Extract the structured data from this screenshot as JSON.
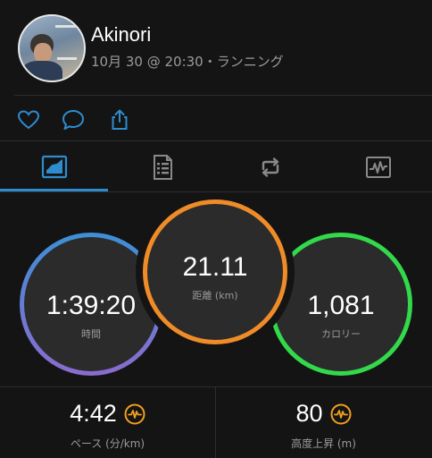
{
  "header": {
    "user_name": "Akinori",
    "activity_meta": "10月 30 @ 20:30・ランニング"
  },
  "actions": {
    "like_icon": "heart-icon",
    "comment_icon": "speech-bubble-icon",
    "share_icon": "share-icon"
  },
  "tabs": [
    {
      "icon": "summary-chart-icon",
      "selected": true
    },
    {
      "icon": "details-list-icon",
      "selected": false
    },
    {
      "icon": "laps-loop-icon",
      "selected": false
    },
    {
      "icon": "graph-icon",
      "selected": false
    }
  ],
  "rings": {
    "time": {
      "value": "1:39:20",
      "label": "時間"
    },
    "distance": {
      "value": "21.11",
      "label": "距離 (km)"
    },
    "calories": {
      "value": "1,081",
      "label": "カロリー"
    }
  },
  "stats": {
    "pace": {
      "value": "4:42",
      "label": "ペース (分/km)"
    },
    "elevation": {
      "value": "80",
      "label": "高度上昇 (m)"
    }
  },
  "colors": {
    "background": "#141414",
    "accent_blue": "#2e8ccf",
    "ring_orange": "#f08c28",
    "ring_green": "#32d94b",
    "ring_blue": "#3d8fd6",
    "ring_purple": "#8a6ccf",
    "badge_orange": "#f0a020"
  }
}
